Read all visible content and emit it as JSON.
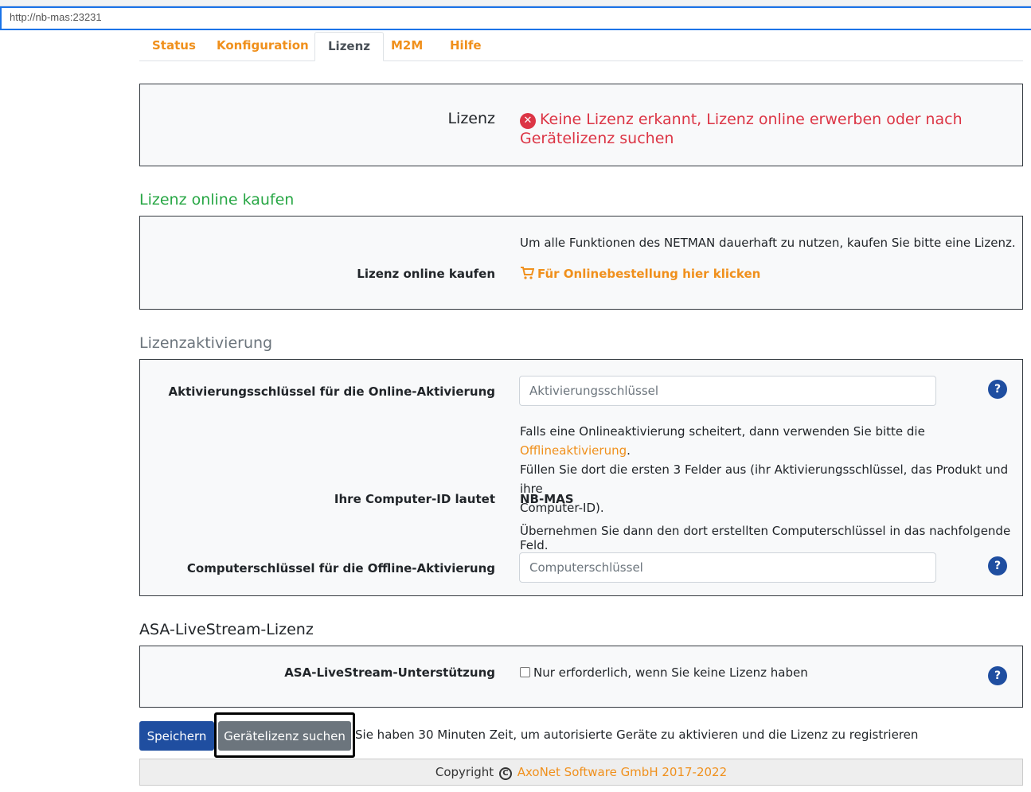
{
  "browser": {
    "url": "http://nb-mas:23231"
  },
  "tabs": [
    "Status",
    "Konfiguration",
    "Lizenz",
    "M2M",
    "Hilfe"
  ],
  "license_status": {
    "label": "Lizenz",
    "message_line1": "Keine Lizenz erkannt, Lizenz online erwerben oder nach",
    "message_line2": "Gerätelizenz suchen"
  },
  "buy": {
    "section_title": "Lizenz online kaufen",
    "info": "Um alle Funktionen des NETMAN dauerhaft zu nutzen, kaufen Sie bitte eine Lizenz.",
    "label": "Lizenz online kaufen",
    "link": "Für Onlinebestellung hier klicken"
  },
  "activation": {
    "section_title": "Lizenzaktivierung",
    "key_label": "Aktivierungsschlüssel für die Online-Aktivierung",
    "key_placeholder": "Aktivierungsschlüssel",
    "offline_text_before": "Falls eine Onlineaktivierung scheitert, dann verwenden Sie bitte die ",
    "offline_link": "Offlineaktivierung",
    "offline_text_after": ".",
    "offline_line2": "Füllen Sie dort die ersten 3 Felder aus (ihr Aktivierungsschlüssel, das Produkt und ihre",
    "offline_line3": "Computer-ID).",
    "computer_id_label": "Ihre Computer-ID lautet",
    "computer_id_value": "NB-MAS",
    "transfer_text": "Übernehmen Sie dann den dort erstellten Computerschlüssel in das nachfolgende Feld.",
    "computer_key_label": "Computerschlüssel für die Offline-Aktivierung",
    "computer_key_placeholder": "Computerschlüssel"
  },
  "livestream": {
    "section_title": "ASA-LiveStream-Lizenz",
    "label": "ASA-LiveStream-Unterstützung",
    "checkbox_text": "Nur erforderlich, wenn Sie keine Lizenz haben"
  },
  "actions": {
    "save": "Speichern",
    "search": "Gerätelizenz suchen",
    "hint": "Sie haben 30 Minuten Zeit, um autorisierte Geräte zu aktivieren und die Lizenz zu registrieren"
  },
  "footer": {
    "copyright": "Copyright",
    "company": "AxoNet Software GmbH 2017-2022"
  },
  "help_glyph": "?",
  "colors": {
    "accent_orange": "#f0901c",
    "error_red": "#dc3545",
    "success_green": "#28a745",
    "primary_blue": "#1f4ea0",
    "button_gray": "#6c757d"
  }
}
